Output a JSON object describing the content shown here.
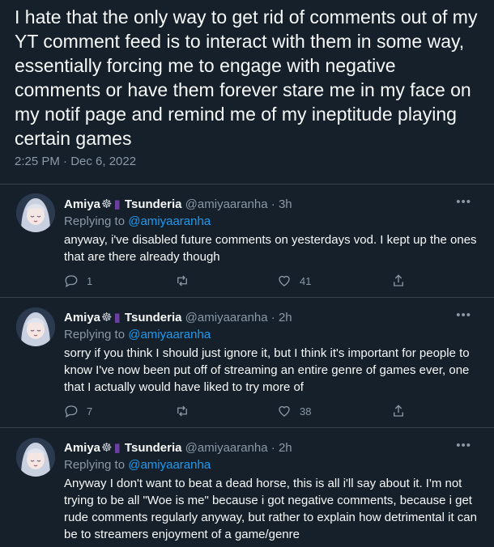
{
  "main_tweet": {
    "text": "I hate that the only way to get rid of comments out of my YT comment feed is to interact with them in some way, essentially forcing me to engage with negative comments or have them forever stare me in my face on my notif page and remind me of my ineptitude playing certain games",
    "timestamp": "2:25 PM · Dec 6, 2022"
  },
  "replies": [
    {
      "name": "Amiya",
      "name_suffix": "Tsunderia",
      "emoji1": "☸",
      "emoji2": "▮",
      "handle": "@amiyaaranha",
      "sep": "·",
      "time": "3h",
      "replying_label": "Replying to",
      "replying_to": "@amiyaaranha",
      "text": "anyway, i've disabled future comments on yesterdays vod. I kept up the ones that are there already though",
      "reply_count": "1",
      "retweet_count": "",
      "like_count": "41"
    },
    {
      "name": "Amiya",
      "name_suffix": "Tsunderia",
      "emoji1": "☸",
      "emoji2": "▮",
      "handle": "@amiyaaranha",
      "sep": "·",
      "time": "2h",
      "replying_label": "Replying to",
      "replying_to": "@amiyaaranha",
      "text": "sorry if you think I should just ignore it, but I think it's important for people to know I've now been put off of streaming an entire genre of games ever, one that I actually would have liked to try more of",
      "reply_count": "7",
      "retweet_count": "",
      "like_count": "38"
    },
    {
      "name": "Amiya",
      "name_suffix": "Tsunderia",
      "emoji1": "☸",
      "emoji2": "▮",
      "handle": "@amiyaaranha",
      "sep": "·",
      "time": "2h",
      "replying_label": "Replying to",
      "replying_to": "@amiyaaranha",
      "text": "Anyway I don't want to beat a dead horse, this is all i'll say about it. I'm not trying to be all \"Woe is me\" because i got negative comments, because i get rude comments regularly anyway, but rather to explain how detrimental it can be to streamers enjoyment of a game/genre"
    }
  ],
  "icons": {
    "more": "more-icon",
    "reply": "reply-icon",
    "retweet": "retweet-icon",
    "like": "like-icon",
    "share": "share-icon"
  },
  "colors": {
    "background": "#15202b",
    "text": "#f7f9f9",
    "muted": "#8b98a5",
    "link": "#1d9bf0",
    "divider": "#38444d"
  }
}
